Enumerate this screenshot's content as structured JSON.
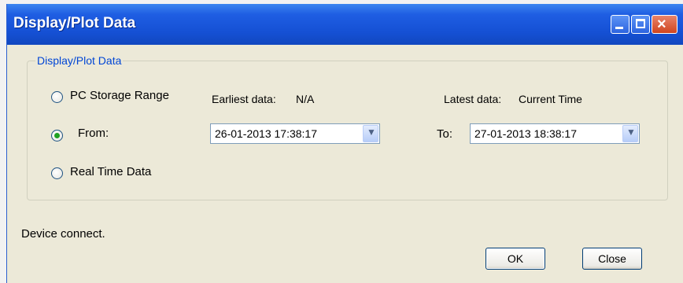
{
  "window": {
    "title": "Display/Plot Data",
    "controls": {
      "minimize": "minimize-icon",
      "maximize": "maximize-icon",
      "close": "×"
    }
  },
  "group": {
    "legend": "Display/Plot Data",
    "options": {
      "pc_storage": {
        "label": "PC Storage Range",
        "selected": false
      },
      "from": {
        "label": "From:",
        "selected": true
      },
      "real_time": {
        "label": "Real Time Data",
        "selected": false
      }
    },
    "earliest": {
      "label": "Earliest data:",
      "value": "N/A"
    },
    "latest": {
      "label": "Latest data:",
      "value": "Current Time"
    },
    "from_value": "26-01-2013 17:38:17",
    "to_label": "To:",
    "to_value": "27-01-2013 18:38:17"
  },
  "status": "Device connect.",
  "buttons": {
    "ok": "OK",
    "close": "Close"
  },
  "colors": {
    "titlebar": "#1550d4",
    "legend": "#0046d5",
    "background": "#ece9d8",
    "radio_dot": "#21a121",
    "close_button": "#d0451f"
  }
}
